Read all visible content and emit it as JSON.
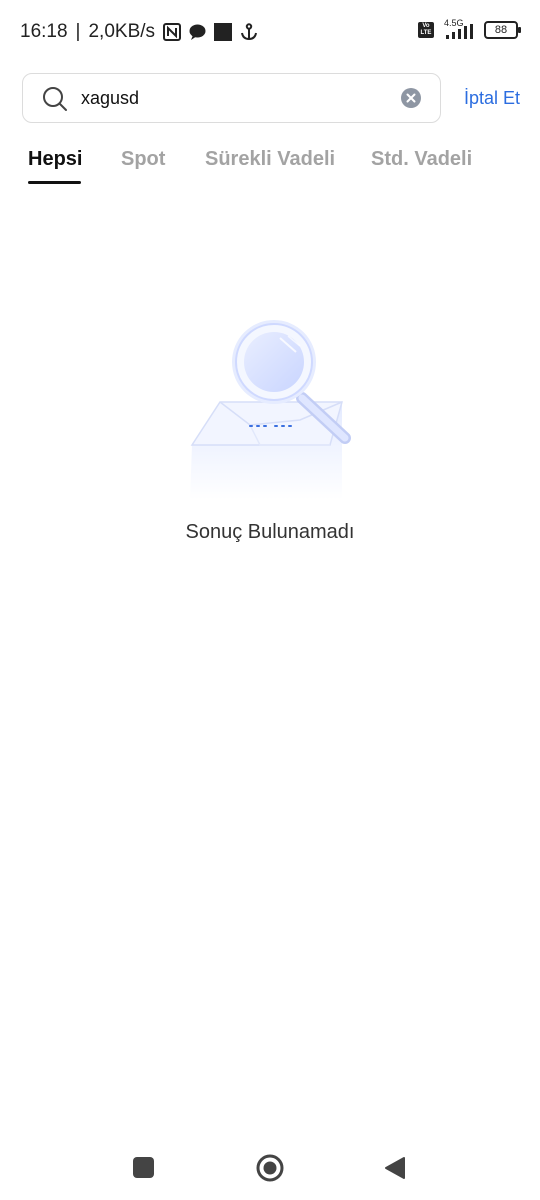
{
  "status_bar": {
    "time": "16:18",
    "separator": "|",
    "net_speed": "2,0KB/s",
    "network_type": "4.5G",
    "volte": "Vo LTE",
    "battery": "88",
    "icons": [
      "nfc-icon",
      "chat-bubble-icon",
      "square-notification-icon",
      "anchor-icon",
      "volte-icon",
      "signal-icon",
      "battery-icon"
    ]
  },
  "search": {
    "value": "xagusd",
    "placeholder": "",
    "cancel_label": "İptal Et"
  },
  "tabs": [
    {
      "label": "Hepsi",
      "active": true
    },
    {
      "label": "Spot",
      "active": false
    },
    {
      "label": "Sürekli Vadeli",
      "active": false
    },
    {
      "label": "Std. Vadeli",
      "active": false
    }
  ],
  "empty_state": {
    "message": "Sonuç Bulunamadı"
  },
  "colors": {
    "accent": "#2b6de0",
    "active_tab": "#111111",
    "inactive_tab": "#a3a3a3",
    "illustration": "#dbe4ff"
  }
}
